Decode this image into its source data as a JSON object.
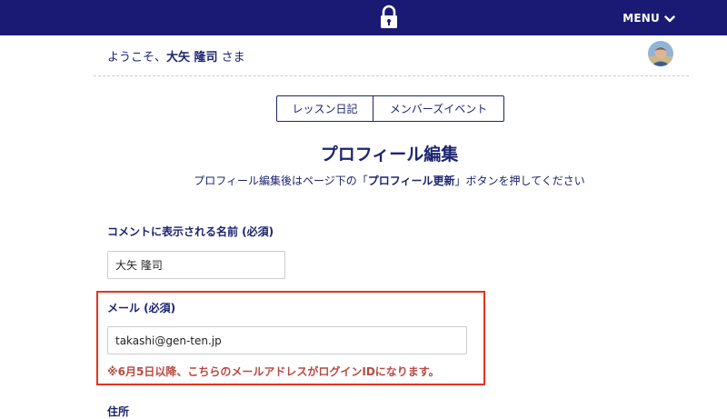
{
  "header": {
    "menu_label": "MENU",
    "icons": {
      "logo": "lock-icon",
      "menu": "chevron-down-icon"
    }
  },
  "welcome": {
    "prefix": "ようこそ、",
    "user_name": "大矢 隆司",
    "suffix": " さま"
  },
  "tabs": [
    {
      "label": "レッスン日記"
    },
    {
      "label": "メンバーズイベント"
    }
  ],
  "page": {
    "title": "プロフィール編集",
    "instructions_prefix": "プロフィール編集後はページ下の「",
    "instructions_emphasis": "プロフィール更新",
    "instructions_suffix": "」ボタンを押してください"
  },
  "form": {
    "display_name_label": "コメントに表示される名前 (必須)",
    "display_name_value": "大矢 隆司",
    "email_label": "メール (必須)",
    "email_value": "takashi@gen-ten.jp",
    "email_notice": "※6月5日以降、こちらのメールアドレスがログインIDになります。",
    "next_label_partial": "住所"
  },
  "colors": {
    "header_bg": "#1a1a75",
    "text_primary": "#1d2470",
    "highlight_border": "#e2341a",
    "notice_text": "#b84a42"
  }
}
